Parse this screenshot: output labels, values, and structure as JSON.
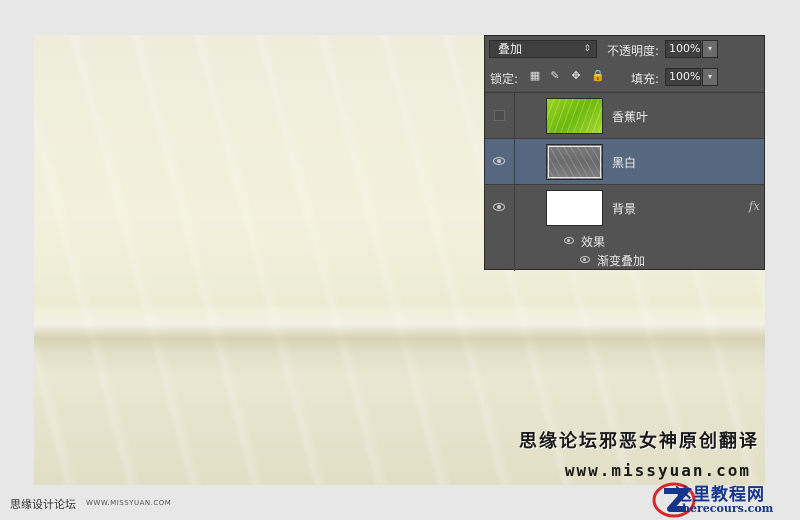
{
  "canvas": {
    "credit_cn": "思缘论坛邪恶女神原创翻译",
    "credit_url": "www.missyuan.com"
  },
  "footer": {
    "site_name": "思缘设计论坛",
    "site_url": "WWW.MISSYUAN.COM"
  },
  "watermark": {
    "logo_cn": "这里教程网",
    "logo_en": "herecours.com"
  },
  "layers_panel": {
    "blend_mode": "叠加",
    "opacity_label": "不透明度:",
    "opacity_value": "100%",
    "lock_label": "锁定:",
    "fill_label": "填充:",
    "fill_value": "100%",
    "layers": [
      {
        "name": "香蕉叶",
        "visible": false,
        "selected": false,
        "thumb": "green-leaf"
      },
      {
        "name": "黑白",
        "visible": true,
        "selected": true,
        "thumb": "gray-leaf"
      },
      {
        "name": "背景",
        "visible": true,
        "selected": false,
        "thumb": "white",
        "fx": "fx"
      }
    ],
    "effects_label": "效果",
    "effect_items": [
      "渐变叠加"
    ]
  },
  "colors": {
    "panel_bg": "#535353",
    "selected_row": "#56677f",
    "logo_blue": "#16358c",
    "logo_red": "#d8262a"
  }
}
